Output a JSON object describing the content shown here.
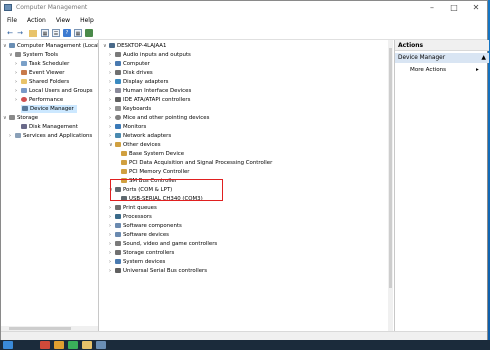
{
  "window": {
    "title": "Computer Management"
  },
  "menu": [
    "File",
    "Action",
    "View",
    "Help"
  ],
  "tree": {
    "root": "Computer Management (Local",
    "system_tools": "System Tools",
    "task_scheduler": "Task Scheduler",
    "event_viewer": "Event Viewer",
    "shared_folders": "Shared Folders",
    "local_users": "Local Users and Groups",
    "performance": "Performance",
    "device_manager": "Device Manager",
    "storage": "Storage",
    "disk_management": "Disk Management",
    "services": "Services and Applications"
  },
  "devices": {
    "computer_name": "DESKTOP-4LAJAA1",
    "items": [
      "Audio inputs and outputs",
      "Computer",
      "Disk drives",
      "Display adapters",
      "Human Interface Devices",
      "IDE ATA/ATAPI controllers",
      "Keyboards",
      "Mice and other pointing devices",
      "Monitors",
      "Network adapters",
      "Other devices",
      "Base System Device",
      "PCI Data Acquisition and Signal Processing Controller",
      "PCI Memory Controller",
      "SM Bus Controller",
      "Ports (COM & LPT)",
      "USB-SERIAL CH340 (COM3)",
      "Print queues",
      "Processors",
      "Software components",
      "Software devices",
      "Sound, video and game controllers",
      "Storage controllers",
      "System devices",
      "Universal Serial Bus controllers"
    ]
  },
  "actions": {
    "header": "Actions",
    "selected": "Device Manager",
    "more": "More Actions"
  },
  "colors": {
    "highlight_box": "#e02020",
    "selection": "#cce8ff"
  }
}
